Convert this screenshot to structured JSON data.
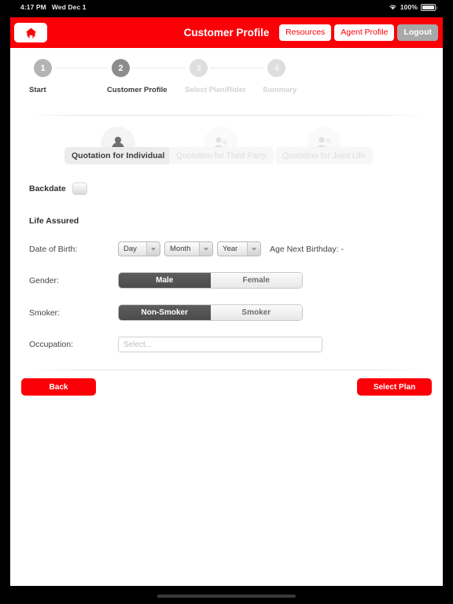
{
  "statusbar": {
    "time": "4:17 PM",
    "date": "Wed Dec 1",
    "battery_percent": "100%",
    "wifi_icon": "wifi-icon",
    "battery_icon": "battery-icon"
  },
  "navbar": {
    "home_icon": "home-icon",
    "title": "Customer Profile",
    "buttons": [
      {
        "label": "Resources",
        "style": "light"
      },
      {
        "label": "Agent Profile",
        "style": "light"
      },
      {
        "label": "Logout",
        "style": "grey"
      }
    ]
  },
  "stepper": {
    "steps": [
      {
        "number": "1",
        "label": "Start",
        "state": "done"
      },
      {
        "number": "2",
        "label": "Customer Profile",
        "state": "active"
      },
      {
        "number": "3",
        "label": "Select Plan/Rider",
        "state": "dim"
      },
      {
        "number": "4",
        "label": "Summary",
        "state": "dim"
      }
    ]
  },
  "quotation_tabs": [
    {
      "label": "Quotation for Individual",
      "icon": "single-person-icon",
      "state": "active"
    },
    {
      "label": "Quotation for Third Party",
      "icon": "two-person-icon",
      "state": "inactive"
    },
    {
      "label": "Quotation for Joint Life",
      "icon": "joint-life-icon",
      "state": "inactive"
    }
  ],
  "form": {
    "backdate_label": "Backdate",
    "backdate_checked": false,
    "section_title": "Life Assured",
    "dob": {
      "label": "Date of Birth:",
      "day": "Day",
      "month": "Month",
      "year": "Year",
      "age_text": "Age Next Birthday: -"
    },
    "gender": {
      "label": "Gender:",
      "options": [
        "Male",
        "Female"
      ],
      "selected": "Male"
    },
    "smoker": {
      "label": "Smoker:",
      "options": [
        "Non-Smoker",
        "Smoker"
      ],
      "selected": "Non-Smoker"
    },
    "occupation": {
      "label": "Occupation:",
      "value": "",
      "placeholder": "Select..."
    }
  },
  "footer": {
    "back_label": "Back",
    "next_label": "Select Plan"
  },
  "colors": {
    "brand_red": "#fb0007",
    "nav_grey": "#a8a8a8",
    "segment_on": "#4f4f4f",
    "step_active": "#8c8c8c",
    "step_done": "#b4b4b4",
    "step_dim": "#dedede"
  }
}
